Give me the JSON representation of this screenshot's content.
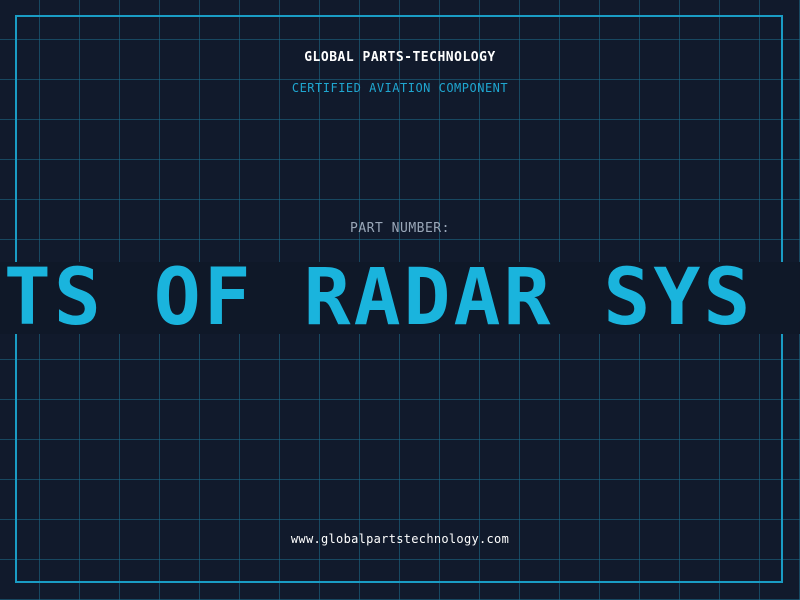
{
  "header": {
    "company": "GLOBAL PARTS-TECHNOLOGY",
    "subtitle": "CERTIFIED AVIATION COMPONENT"
  },
  "part": {
    "label": "PART NUMBER:",
    "value": "MENTS OF RADAR SYS"
  },
  "footer": {
    "url": "www.globalpartstechnology.com"
  },
  "colors": {
    "background": "#111a2c",
    "grid": "#1c6e8c",
    "accent": "#1ab4dd",
    "frame": "#1a9cc4"
  }
}
